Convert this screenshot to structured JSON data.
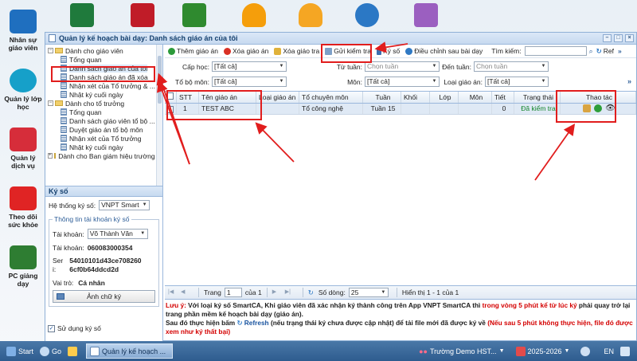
{
  "side_apps": [
    {
      "label": "Nhân sự\ngiáo viên"
    },
    {
      "label": "Quản lý lớp\nhọc"
    },
    {
      "label": "Quản lý\ndịch vụ"
    },
    {
      "label": "Theo dõi\nsức khỏe"
    },
    {
      "label": "PC giảng\ndạy"
    }
  ],
  "window": {
    "title": "Quản lý kế hoạch bài dạy: Danh sách giáo án của tôi"
  },
  "tree": {
    "groups": [
      {
        "label": "Dành cho giáo viên",
        "items": [
          "Tổng quan",
          "Danh sách giáo án của tôi",
          "Danh sách giáo án đã xóa",
          "Nhận xét của Tổ trưởng & ...",
          "Nhật ký cuối ngày"
        ]
      },
      {
        "label": "Dành cho tổ trưởng",
        "items": [
          "Tổng quan",
          "Danh sách giáo viên tổ bộ ...",
          "Duyệt giáo án tổ bộ môn",
          "Nhận xét của Tổ trưởng",
          "Nhật ký cuối ngày"
        ]
      },
      {
        "label": "Dành cho Ban giám hiệu trường ...",
        "items": []
      }
    ]
  },
  "kyso": {
    "header": "Ký số",
    "system_label": "Hệ thống ký số:",
    "system_value": "VNPT Smart",
    "account_legend": "Thông tin tài khoản ký số",
    "account_label": "Tài khoản:",
    "account_value": "Võ Thành Văn",
    "account_label2": "Tài khoản:",
    "account_number": "060083000354",
    "serial_label": "Ser\ni:",
    "serial_value": "54010101d43ce708260\n6cf0b64ddcd2d",
    "role_label": "Vai trò:",
    "role_value": "Cá nhân",
    "sig_button": "Ảnh chữ ký",
    "use_sig": "Sử dụng ký số"
  },
  "toolbar": {
    "add": "Thêm giáo án",
    "delete": "Xóa giáo án",
    "delete_check": "Xóa giáo tra",
    "send": "Gửi kiểm tra",
    "sign": "Ký số",
    "adjust": "Điều chỉnh sau bài dạy",
    "search_label": "Tìm kiếm:",
    "refresh": "Ref"
  },
  "filters": {
    "grade_label": "Cấp học:",
    "grade_value": "[Tất cả]",
    "from_week_label": "Từ tuần:",
    "from_week_value": "Chọn tuần",
    "to_week_label": "Đến tuần:",
    "to_week_value": "Chọn tuần",
    "dept_label": "Tổ bộ môn:",
    "dept_value": "[Tất cả]",
    "subject_label": "Môn:",
    "subject_value": "[Tất cả]",
    "type_label": "Loại giáo án:",
    "type_value": "[Tất cả]"
  },
  "table": {
    "columns": [
      "STT",
      "Tên giáo án",
      "Loại giáo án",
      "Tổ chuyên môn",
      "Tuần",
      "Khối",
      "Lớp",
      "Môn",
      "Tiết",
      "Trạng thái",
      "Thao tác"
    ],
    "rows": [
      {
        "stt": "1",
        "name": "TEST ABC",
        "type": "",
        "dept": "Tổ công nghệ",
        "week": "Tuần 15",
        "block": "",
        "class": "",
        "subject": "",
        "period": "0",
        "status": "Đã kiểm tra"
      }
    ]
  },
  "pager": {
    "page_label": "Trang",
    "page_value": "1",
    "of_label": "của 1",
    "rows_label": "Số dòng:",
    "rows_value": "25",
    "display": "Hiển thị 1 - 1 của 1"
  },
  "note": {
    "prefix": "Lưu ý:",
    "text1": "Với loại ký số SmartCA, Khi giáo viên đã xác nhận ký thành công trên App VNPT SmartCA thì",
    "red1": "trong vòng 5 phút kể từ lúc ký",
    "text2": "phải quay trở lại trang phần mềm kế hoạch bài dạy (giáo án).",
    "text3": "Sau đó thực hiện bấm",
    "refresh": "Refresh",
    "text4": "(nếu trạng thái ký chưa được cập nhật) để tải file mới đã được ký về",
    "red2": "(Nếu sau 5 phút không thực hiện, file đó được xem như ký thất bại)"
  },
  "taskbar": {
    "start": "Start",
    "go": "Go",
    "active_window": "Quản lý kế hoạch ...",
    "school": "Trường Demo HST...",
    "year": "2025-2026",
    "lang": "EN"
  }
}
